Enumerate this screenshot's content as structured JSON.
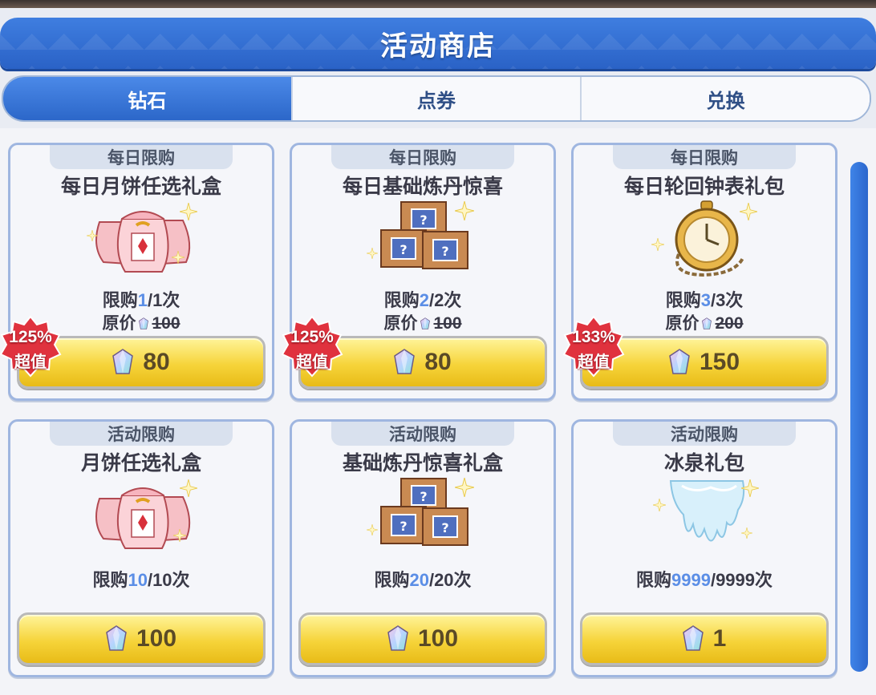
{
  "header": {
    "title": "活动商店"
  },
  "tabs": [
    {
      "label": "钻石",
      "active": true
    },
    {
      "label": "点券",
      "active": false
    },
    {
      "label": "兑换",
      "active": false
    }
  ],
  "colors": {
    "header": "#2a62c6",
    "button": "#f6d43a",
    "badge": "#e0323e",
    "limit_highlight": "#5b8ee6"
  },
  "items": [
    {
      "tag": "每日限购",
      "name": "每日月饼任选礼盒",
      "icon": "mooncake-bags-icon",
      "limit_prefix": "限购",
      "limit_current": "1",
      "limit_rest": "/1次",
      "orig_label": "原价",
      "orig_price": "100",
      "price": "80",
      "badge_pct": "125%",
      "badge_label": "超值"
    },
    {
      "tag": "每日限购",
      "name": "每日基础炼丹惊喜",
      "icon": "mystery-crates-icon",
      "limit_prefix": "限购",
      "limit_current": "2",
      "limit_rest": "/2次",
      "orig_label": "原价",
      "orig_price": "100",
      "price": "80",
      "badge_pct": "125%",
      "badge_label": "超值"
    },
    {
      "tag": "每日限购",
      "name": "每日轮回钟表礼包",
      "icon": "pocket-watch-icon",
      "limit_prefix": "限购",
      "limit_current": "3",
      "limit_rest": "/3次",
      "orig_label": "原价",
      "orig_price": "200",
      "price": "150",
      "badge_pct": "133%",
      "badge_label": "超值"
    },
    {
      "tag": "活动限购",
      "name": "月饼任选礼盒",
      "icon": "mooncake-bags-icon",
      "limit_prefix": "限购",
      "limit_current": "10",
      "limit_rest": "/10次",
      "price": "100"
    },
    {
      "tag": "活动限购",
      "name": "基础炼丹惊喜礼盒",
      "icon": "mystery-crates-icon",
      "limit_prefix": "限购",
      "limit_current": "20",
      "limit_rest": "/20次",
      "price": "100"
    },
    {
      "tag": "活动限购",
      "name": "冰泉礼包",
      "icon": "ice-spring-icon",
      "limit_prefix": "限购",
      "limit_current": "9999",
      "limit_rest": "/9999次",
      "price": "1"
    }
  ]
}
